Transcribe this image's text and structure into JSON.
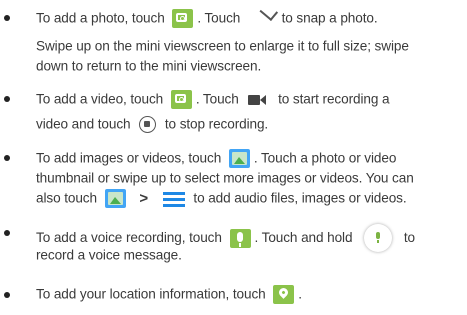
{
  "items": [
    {
      "lines": [
        [
          "To add a photo, touch",
          ". Touch",
          "to snap a photo."
        ],
        [
          "Swipe up on the mini viewscreen to enlarge it to full size; swipe"
        ],
        [
          "down to return to the mini viewscreen."
        ]
      ]
    },
    {
      "lines": [
        [
          "To add a video, touch",
          ". Touch",
          "to start recording a"
        ],
        [
          "video and touch",
          "to stop recording."
        ]
      ]
    },
    {
      "lines": [
        [
          "To add images or videos, touch",
          ". Touch a photo or video"
        ],
        [
          "thumbnail or swipe up to select more images or videos. You can"
        ],
        [
          "also touch",
          ">",
          "to add audio files, images or videos."
        ]
      ]
    },
    {
      "lines": [
        [
          "To add a voice recording, touch",
          ". Touch and hold",
          "to"
        ],
        [
          "record a voice message."
        ]
      ]
    },
    {
      "lines": [
        [
          "To add your location information, touch",
          "."
        ]
      ]
    }
  ],
  "icons": {
    "camera": "camera-icon",
    "check": "check-icon",
    "video": "video-camera-icon",
    "stop": "stop-record-icon",
    "gallery": "gallery-icon",
    "menu": "menu-icon",
    "mic": "microphone-icon",
    "location": "location-pin-icon"
  },
  "colors": {
    "icon_green": "#8bc34a",
    "icon_blue": "#1e88e5",
    "text": "#3a3a3a"
  }
}
